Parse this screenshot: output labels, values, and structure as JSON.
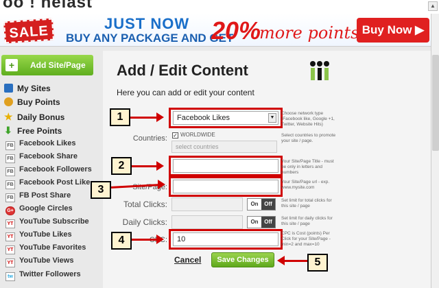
{
  "app": {
    "brand": "oo ! nelast"
  },
  "banner": {
    "sale": "SALE",
    "line1": "JUST NOW",
    "line2": "BUY ANY PACKAGE AND GET",
    "percent": "20%",
    "more": "more points",
    "buy_now": "Buy Now ▶"
  },
  "sidebar": {
    "add_site": "Add Site/Page",
    "main": [
      {
        "label": "My Sites",
        "icon": "home-icon",
        "color": "#2a6fbf"
      },
      {
        "label": "Buy Points",
        "icon": "coins-icon",
        "color": "#e0a020"
      },
      {
        "label": "Daily Bonus",
        "icon": "star-icon",
        "color": "#e8c020"
      },
      {
        "label": "Free Points",
        "icon": "down-arrow-icon",
        "color": "#3fa42a"
      }
    ],
    "sub": [
      {
        "label": "Facebook Likes",
        "icon": "FB"
      },
      {
        "label": "Facebook Share",
        "icon": "FB"
      },
      {
        "label": "Facebook Followers",
        "icon": "FB"
      },
      {
        "label": "Facebook Post Like",
        "icon": "FB"
      },
      {
        "label": "FB Post Share",
        "icon": "FB"
      },
      {
        "label": "Google Circles",
        "icon": "G+"
      },
      {
        "label": "YouTube Subscribe",
        "icon": "YT"
      },
      {
        "label": "YouTube Likes",
        "icon": "YT"
      },
      {
        "label": "YouTube Favorites",
        "icon": "YT"
      },
      {
        "label": "YouTube Views",
        "icon": "YT"
      },
      {
        "label": "Twitter Followers",
        "icon": "tw"
      }
    ]
  },
  "content": {
    "title": "Add / Edit Content",
    "subtitle": "Here you can add or edit your content",
    "network": {
      "value": "Facebook Likes",
      "help": "Choose network type (Facebook like, Google +1, Twitter, Website Hits)"
    },
    "countries": {
      "label": "Countries:",
      "checkbox_label": "WORLDWIDE",
      "placeholder": "select countries",
      "help": "Select countries to promote your site / page."
    },
    "title_field": {
      "value": "",
      "help": "Your Site/Page Title - must be only in letters and numbers"
    },
    "url_field": {
      "label": "Site/Page:",
      "value": "",
      "help": "Your Site/Page url - exp. www.mysite.com"
    },
    "total_clicks": {
      "label": "Total Clicks:",
      "on": "On",
      "off": "Off",
      "help": "Set limit for total clicks for this site / page"
    },
    "daily_clicks": {
      "label": "Daily Clicks:",
      "on": "On",
      "off": "Off",
      "help": "Set limit for daily clicks for this site / page"
    },
    "cpc": {
      "label": "CPC:",
      "value": "10",
      "help": "CPC is Cost (points) Per Click for your Site/Page - min=2 and max=10"
    },
    "cancel": "Cancel",
    "save": "Save Changes"
  },
  "annotations": [
    "1",
    "2",
    "3",
    "4",
    "5"
  ],
  "colors": {
    "accent_green": "#5ea91c",
    "annotation_red": "#d00000",
    "buy_red": "#e02020"
  }
}
